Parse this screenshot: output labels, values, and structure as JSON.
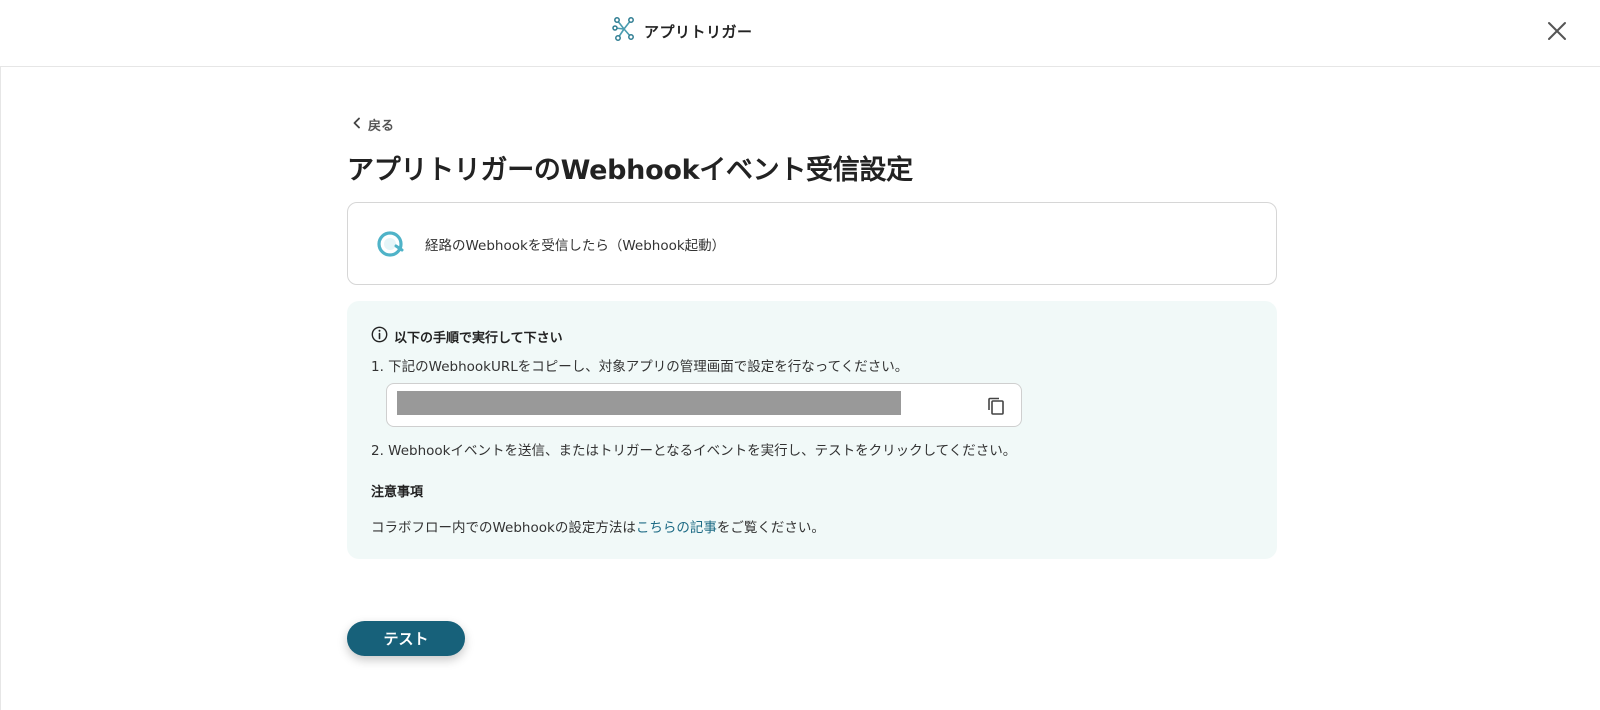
{
  "header": {
    "app_title": "アプリトリガー",
    "close_icon": "close-icon",
    "logo_icon": "app-trigger-icon"
  },
  "nav": {
    "back_label": "戻る"
  },
  "page": {
    "title": "アプリトリガーのWebhookイベント受信設定"
  },
  "trigger": {
    "label": "経路のWebhookを受信したら（Webhook起動）",
    "icon": "webhook-icon"
  },
  "instructions": {
    "heading": "以下の手順で実行して下さい",
    "step1": "1. 下記のWebhookURLをコピーし、対象アプリの管理画面で設定を行なってください。",
    "step2": "2. Webhookイベントを送信、またはトリガーとなるイベントを実行し、テストをクリックしてください。",
    "notes_heading": "注意事項",
    "notes_prefix": "コラボフロー内でのWebhookの設定方法は",
    "notes_link": "こちらの記事",
    "notes_suffix": "をご覧ください。"
  },
  "actions": {
    "test_label": "テスト"
  },
  "colors": {
    "accent": "#17617a",
    "link": "#1e6b85",
    "info_bg": "#f1f9f8",
    "webhook_icon": "#4fb3c8"
  }
}
